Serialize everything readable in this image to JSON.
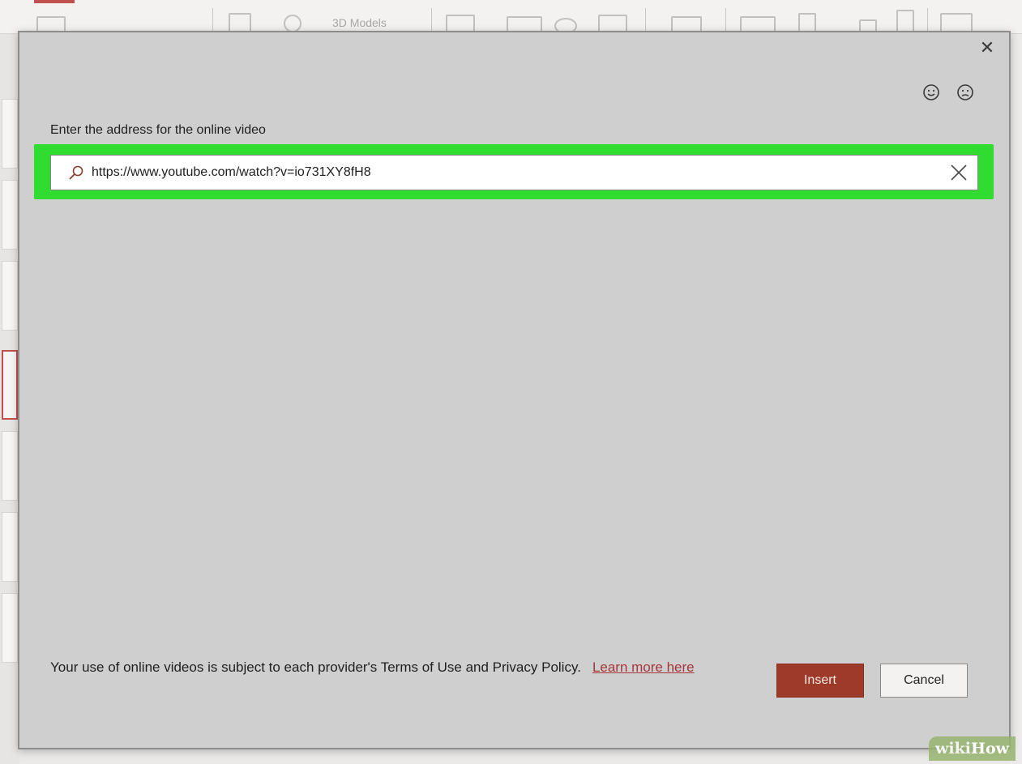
{
  "background_app": {
    "ribbon_item_text": "3D Models"
  },
  "dialog": {
    "close_symbol": "✕",
    "feedback": {
      "smile_icon": "smile-icon",
      "frown_icon": "frown-icon"
    },
    "prompt_label": "Enter the address for the online video",
    "url_input": {
      "value": "https://www.youtube.com/watch?v=io731XY8fH8",
      "search_icon": "search-icon",
      "clear_icon": "clear-icon"
    },
    "footer": {
      "terms_text": "Your use of online videos is subject to each provider's Terms of Use and Privacy Policy.",
      "learn_more_link": "Learn more here"
    },
    "buttons": {
      "insert": "Insert",
      "cancel": "Cancel"
    }
  },
  "watermark": {
    "part_a": "wiki",
    "part_b": "How"
  },
  "colors": {
    "highlight": "#2fdc2f",
    "insert_button": "#9e3a2a",
    "dialog_bg": "#cfcfcf",
    "link": "#a4373a"
  }
}
